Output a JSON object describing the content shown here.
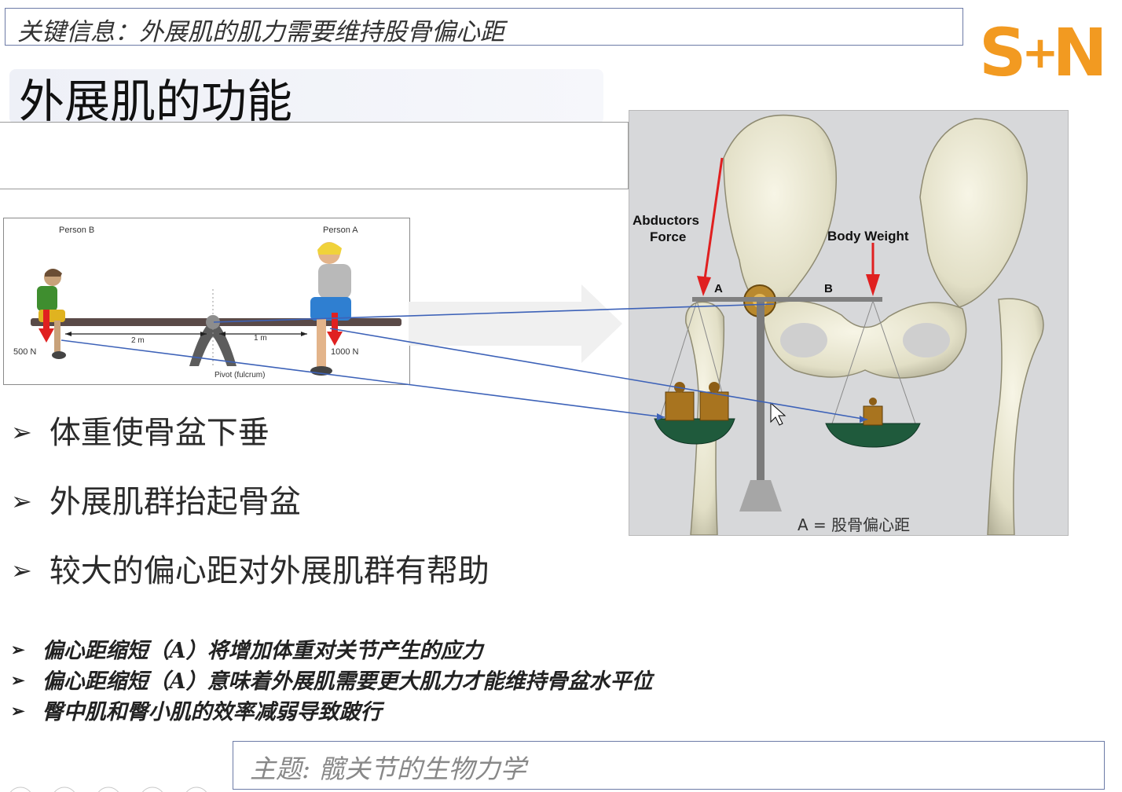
{
  "key_message": "关键信息：外展肌的肌力需要维持股骨偏心距",
  "logo": {
    "text_left": "S",
    "text_plus": "+",
    "text_right": "N",
    "color": "#f29a21"
  },
  "title": "外展肌的功能",
  "seesaw": {
    "person_b": "Person B",
    "person_a": "Person A",
    "force_left": "500 N",
    "force_right": "1000 N",
    "dist_left": "2 m",
    "dist_right": "1 m",
    "pivot": "Pivot (fulcrum)"
  },
  "hip": {
    "abductors_line1": "Abductors",
    "abductors_line2": "Force",
    "body_weight": "Body Weight",
    "label_a": "A",
    "label_b": "B",
    "caption": "A = 股骨偏心距"
  },
  "bullets": [
    "体重使骨盆下垂",
    "外展肌群抬起骨盆",
    "较大的偏心距对外展肌群有帮助"
  ],
  "notes": [
    "偏心距缩短（A）将增加体重对关节产生的应力",
    "偏心距缩短（A）意味着外展肌需要更大肌力才能维持骨盆水平位",
    "臀中肌和臀小肌的效率减弱导致跛行"
  ],
  "bullet_marker": "➢",
  "topic": "主题: 髋关节的生物力学",
  "colors": {
    "frame": "#6c7aa6",
    "force_arrow": "#e02020",
    "connector": "#3d62b8"
  }
}
